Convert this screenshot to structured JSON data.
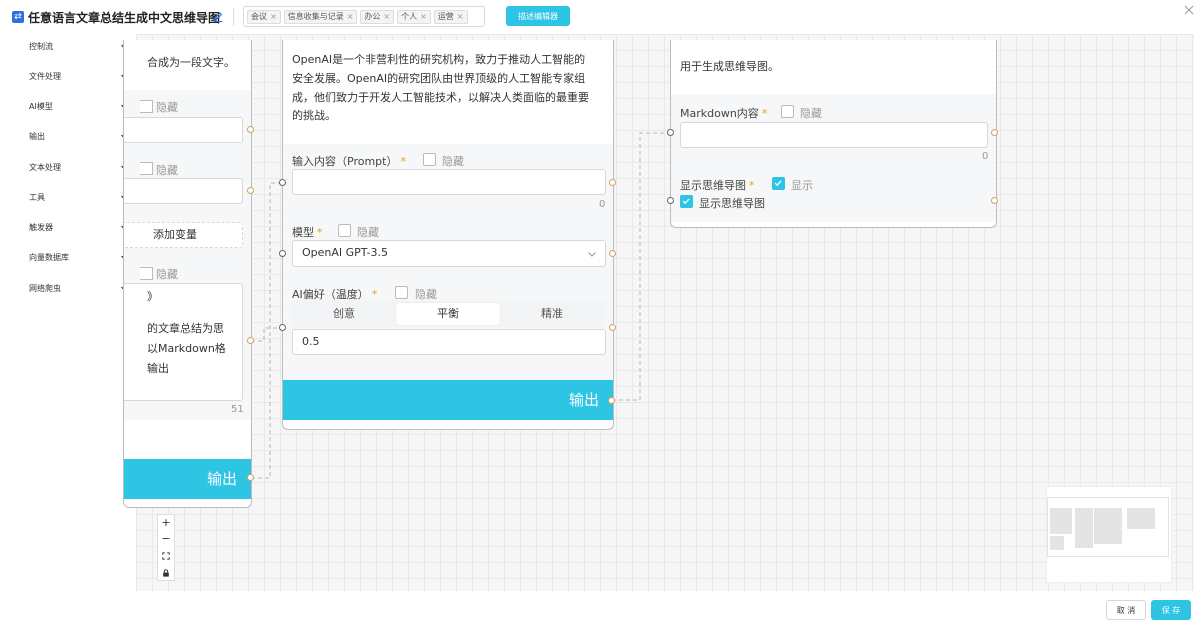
{
  "header": {
    "title": "任意语言文章总结生成中文思维导图",
    "tags": [
      "会议",
      "信息收集与记录",
      "办公",
      "个人",
      "运营"
    ],
    "describe_editor_label": "描述编辑器"
  },
  "sidebar": {
    "items": [
      {
        "label": "控制流",
        "icon": "chevron-down-icon"
      },
      {
        "label": "文件处理",
        "icon": "chevron-down-icon"
      },
      {
        "label": "AI模型",
        "icon": "chevron-down-icon"
      },
      {
        "label": "输出",
        "icon": "chevron-down-icon"
      },
      {
        "label": "文本处理",
        "icon": "chevron-down-icon"
      },
      {
        "label": "工具",
        "icon": "chevron-down-icon"
      },
      {
        "label": "触发器",
        "icon": "chevron-down-icon"
      },
      {
        "label": "向量数据库",
        "icon": "chevron-down-icon"
      },
      {
        "label": "网络爬虫",
        "icon": "chevron-down-icon"
      }
    ]
  },
  "node_left": {
    "desc_fragment": "合成为一段文字。",
    "hide_label_1": "隐藏",
    "hide_label_2": "隐藏",
    "add_variable": "添加变量",
    "hide_label_3": "隐藏",
    "prompt_line_1": "》",
    "prompt_line_2": "的文章总结为思",
    "prompt_line_3": "以Markdown格",
    "prompt_line_4": "输出",
    "char_count": "51",
    "output_label": "输出"
  },
  "node_llm": {
    "desc_lines": [
      "OpenAI是一个非营利性的研究机构，致力于推动人工智能的",
      "安全发展。OpenAI的研究团队由世界顶级的人工智能专家组",
      "成，他们致力于开发人工智能技术，以解决人类面临的最重要",
      "的挑战。"
    ],
    "prompt_label": "输入内容（Prompt）",
    "prompt_required": "*",
    "prompt_hide": "隐藏",
    "prompt_value": "",
    "prompt_count": "0",
    "model_label": "模型",
    "model_required": "*",
    "model_hide": "隐藏",
    "model_value": "OpenAI GPT-3.5",
    "temp_label": "AI偏好（温度）",
    "temp_required": "*",
    "temp_hide": "隐藏",
    "temp_options": [
      "创意",
      "平衡",
      "精准"
    ],
    "temp_selected": "平衡",
    "temp_value": "0.5",
    "output_label": "输出"
  },
  "node_mindmap": {
    "desc": "用于生成思维导图。",
    "markdown_label": "Markdown内容",
    "markdown_required": "*",
    "markdown_hide": "隐藏",
    "markdown_value": "",
    "markdown_count": "0",
    "show_label": "显示思维导图",
    "show_required": "*",
    "show_toggle_label": "显示",
    "show_checkbox_label": "显示思维导图"
  },
  "zoom_controls": {
    "zoom_in": "+",
    "zoom_out": "−"
  },
  "footer": {
    "cancel": "取 消",
    "save": "保 存"
  },
  "colors": {
    "accent": "#2ec4e3",
    "port_border": "#c9a75d"
  }
}
